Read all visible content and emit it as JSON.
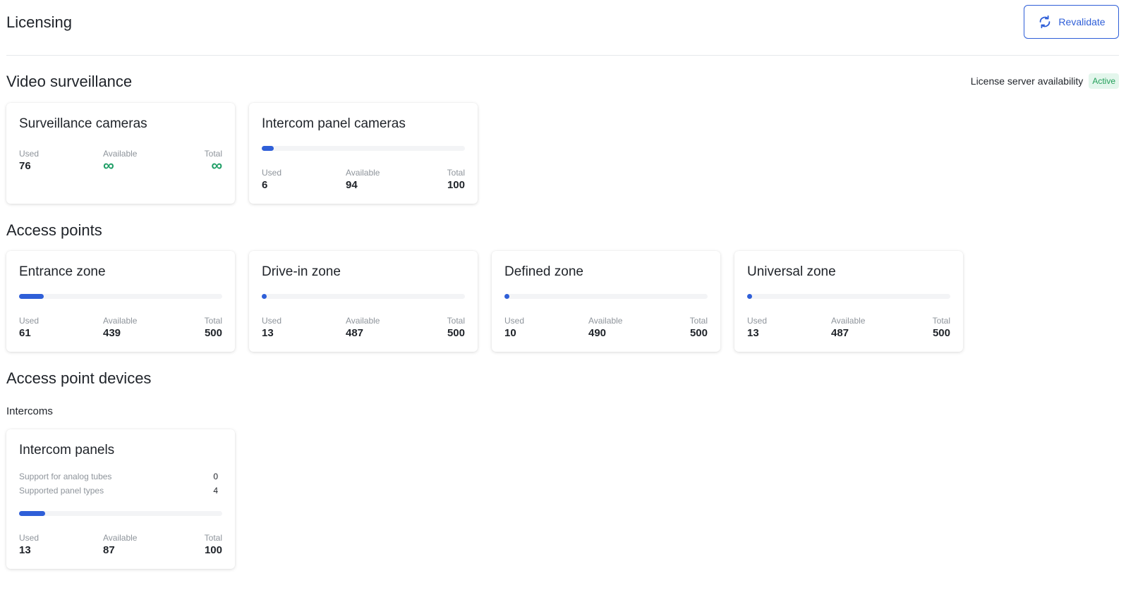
{
  "header": {
    "title": "Licensing",
    "revalidate_label": "Revalidate"
  },
  "server": {
    "label": "License server availability",
    "status": "Active"
  },
  "labels": {
    "used": "Used",
    "available": "Available",
    "total": "Total"
  },
  "sections": {
    "video": "Video surveillance",
    "access_points": "Access points",
    "devices": "Access point devices",
    "intercoms": "Intercoms"
  },
  "cards": {
    "surveillance": {
      "title": "Surveillance cameras",
      "used": "76",
      "available": "∞",
      "total": "∞"
    },
    "intercom_cameras": {
      "title": "Intercom panel cameras",
      "used": "6",
      "available": "94",
      "total": "100",
      "fill": 0.06
    },
    "entrance": {
      "title": "Entrance zone",
      "used": "61",
      "available": "439",
      "total": "500",
      "fill": 0.122
    },
    "drivein": {
      "title": "Drive-in zone",
      "used": "13",
      "available": "487",
      "total": "500",
      "fill": 0.026
    },
    "defined": {
      "title": "Defined zone",
      "used": "10",
      "available": "490",
      "total": "500",
      "fill": 0.02
    },
    "universal": {
      "title": "Universal zone",
      "used": "13",
      "available": "487",
      "total": "500",
      "fill": 0.026
    },
    "intercom_panels": {
      "title": "Intercom panels",
      "features": [
        {
          "label": "Support for analog tubes",
          "value": "0"
        },
        {
          "label": "Supported panel types",
          "value": "4"
        }
      ],
      "used": "13",
      "available": "87",
      "total": "100",
      "fill": 0.13
    }
  },
  "colors": {
    "accent": "#2f5fd8",
    "active": "#23a05a",
    "infinity": "#1f9e66"
  }
}
